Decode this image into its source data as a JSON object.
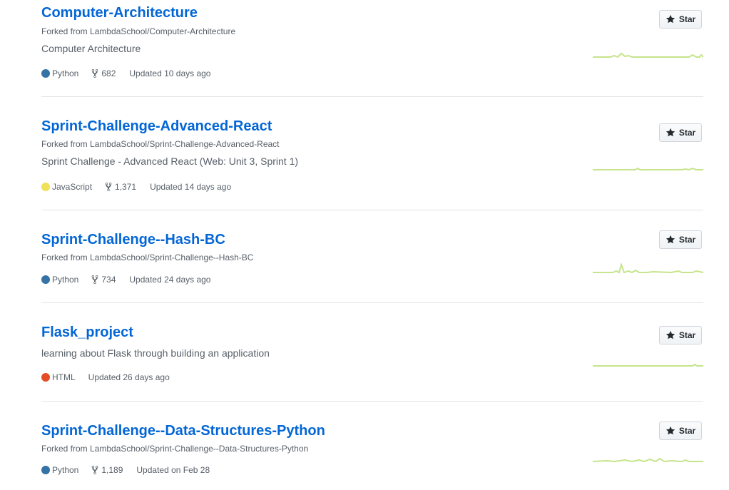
{
  "repos": [
    {
      "name": "Computer-Architecture",
      "forked_prefix": "Forked from ",
      "forked_from": "LambdaSchool/Computer-Architecture",
      "description": "Computer Architecture",
      "language": "Python",
      "language_color": "#3572A5",
      "forks": "682",
      "updated": "Updated 10 days ago",
      "star_label": "Star"
    },
    {
      "name": "Sprint-Challenge-Advanced-React",
      "forked_prefix": "Forked from ",
      "forked_from": "LambdaSchool/Sprint-Challenge-Advanced-React",
      "description": "Sprint Challenge - Advanced React (Web: Unit 3, Sprint 1)",
      "language": "JavaScript",
      "language_color": "#f1e05a",
      "forks": "1,371",
      "updated": "Updated 14 days ago",
      "star_label": "Star"
    },
    {
      "name": "Sprint-Challenge--Hash-BC",
      "forked_prefix": "Forked from ",
      "forked_from": "LambdaSchool/Sprint-Challenge--Hash-BC",
      "description": "",
      "language": "Python",
      "language_color": "#3572A5",
      "forks": "734",
      "updated": "Updated 24 days ago",
      "star_label": "Star"
    },
    {
      "name": "Flask_project",
      "forked_prefix": "",
      "forked_from": "",
      "description": "learning about Flask through building an application",
      "language": "HTML",
      "language_color": "#e34c26",
      "forks": "",
      "updated": "Updated 26 days ago",
      "star_label": "Star"
    },
    {
      "name": "Sprint-Challenge--Data-Structures-Python",
      "forked_prefix": "Forked from ",
      "forked_from": "LambdaSchool/Sprint-Challenge--Data-Structures-Python",
      "description": "",
      "language": "Python",
      "language_color": "#3572A5",
      "forks": "1,189",
      "updated": "Updated on Feb 28",
      "star_label": "Star"
    }
  ],
  "colors": {
    "link": "#0366d6",
    "muted": "#586069",
    "sparkline": "#c6e48b"
  },
  "icons": {
    "star": "star-icon",
    "fork": "repo-forked-icon"
  }
}
